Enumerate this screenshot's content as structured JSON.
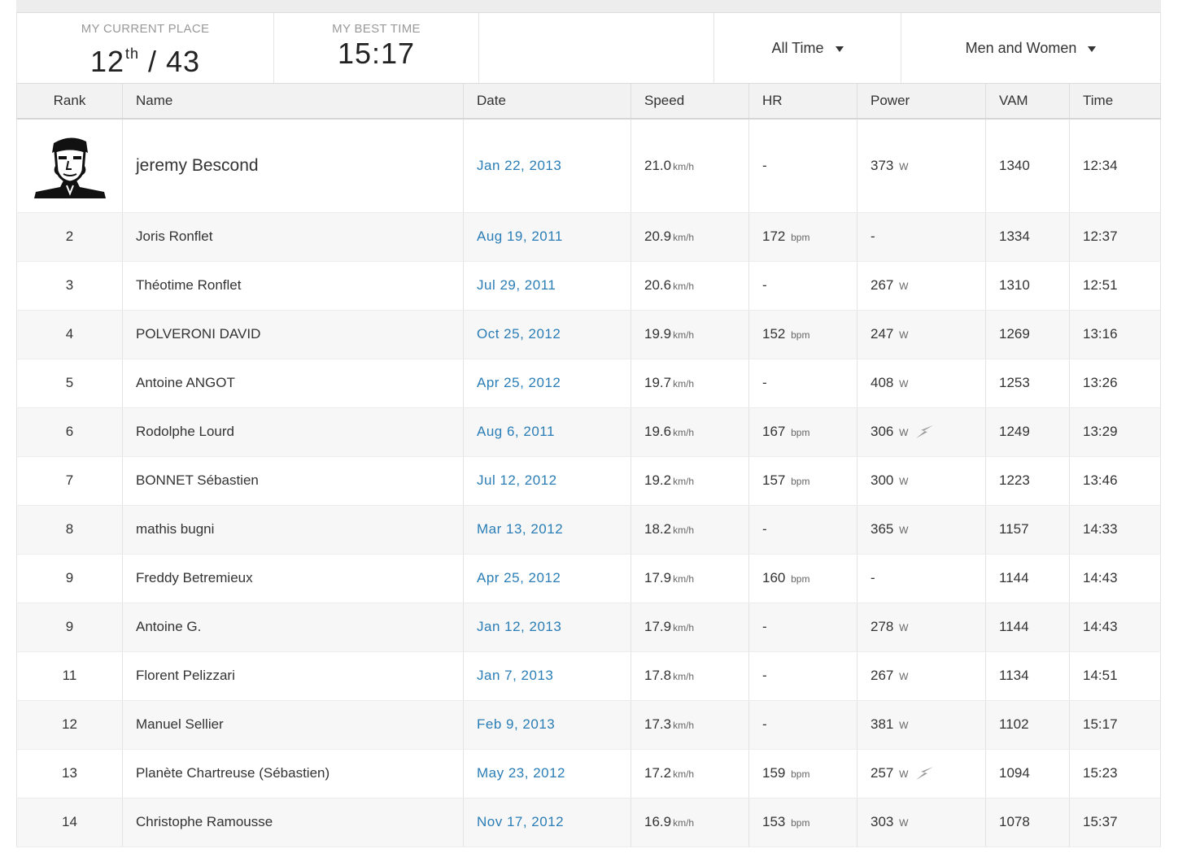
{
  "summary": {
    "current_place_label": "MY CURRENT PLACE",
    "current_place_rank": "12",
    "current_place_suffix": "th",
    "current_place_total": "/ 43",
    "best_time_label": "MY BEST TIME",
    "best_time_value": "15:17"
  },
  "filters": {
    "time_range": "All Time",
    "gender": "Men and Women"
  },
  "columns": [
    "Rank",
    "Name",
    "Date",
    "Speed",
    "HR",
    "Power",
    "VAM",
    "Time"
  ],
  "units": {
    "speed": "km/h",
    "hr": "bpm",
    "power": "W"
  },
  "leader": {
    "name": "jeremy Bescond",
    "date": "Jan 22, 2013",
    "speed": "21.0",
    "hr": "-",
    "power": "373",
    "vam": "1340",
    "time": "12:34"
  },
  "rows": [
    {
      "rank": "2",
      "name": "Joris Ronflet",
      "date": "Aug 19, 2011",
      "speed": "20.9",
      "hr": "172",
      "power": "-",
      "vam": "1334",
      "time": "12:37"
    },
    {
      "rank": "3",
      "name": "Théotime Ronflet",
      "date": "Jul 29, 2011",
      "speed": "20.6",
      "hr": "-",
      "power": "267",
      "vam": "1310",
      "time": "12:51"
    },
    {
      "rank": "4",
      "name": "POLVERONI DAVID",
      "date": "Oct 25, 2012",
      "speed": "19.9",
      "hr": "152",
      "power": "247",
      "vam": "1269",
      "time": "13:16"
    },
    {
      "rank": "5",
      "name": "Antoine ANGOT",
      "date": "Apr 25, 2012",
      "speed": "19.7",
      "hr": "-",
      "power": "408",
      "vam": "1253",
      "time": "13:26"
    },
    {
      "rank": "6",
      "name": "Rodolphe Lourd",
      "date": "Aug 6, 2011",
      "speed": "19.6",
      "hr": "167",
      "power": "306",
      "power_meter": true,
      "vam": "1249",
      "time": "13:29"
    },
    {
      "rank": "7",
      "name": "BONNET Sébastien",
      "date": "Jul 12, 2012",
      "speed": "19.2",
      "hr": "157",
      "power": "300",
      "vam": "1223",
      "time": "13:46"
    },
    {
      "rank": "8",
      "name": "mathis bugni",
      "date": "Mar 13, 2012",
      "speed": "18.2",
      "hr": "-",
      "power": "365",
      "vam": "1157",
      "time": "14:33"
    },
    {
      "rank": "9",
      "name": "Freddy Betremieux",
      "date": "Apr 25, 2012",
      "speed": "17.9",
      "hr": "160",
      "power": "-",
      "vam": "1144",
      "time": "14:43"
    },
    {
      "rank": "9",
      "name": "Antoine G.",
      "date": "Jan 12, 2013",
      "speed": "17.9",
      "hr": "-",
      "power": "278",
      "vam": "1144",
      "time": "14:43"
    },
    {
      "rank": "11",
      "name": "Florent Pelizzari",
      "date": "Jan 7, 2013",
      "speed": "17.8",
      "hr": "-",
      "power": "267",
      "vam": "1134",
      "time": "14:51"
    },
    {
      "rank": "12",
      "name": "Manuel Sellier",
      "date": "Feb 9, 2013",
      "speed": "17.3",
      "hr": "-",
      "power": "381",
      "vam": "1102",
      "time": "15:17"
    },
    {
      "rank": "13",
      "name": "Planète Chartreuse (Sébastien)",
      "date": "May 23, 2012",
      "speed": "17.2",
      "hr": "159",
      "power": "257",
      "power_meter": true,
      "vam": "1094",
      "time": "15:23"
    },
    {
      "rank": "14",
      "name": "Christophe Ramousse",
      "date": "Nov 17, 2012",
      "speed": "16.9",
      "hr": "153",
      "power": "303",
      "vam": "1078",
      "time": "15:37"
    }
  ],
  "colors": {
    "link": "#2a7db6",
    "header_bg": "#f2f2f2",
    "stripe_bg": "#f7f7f7"
  },
  "icons": {
    "dropdown": "caret-down-icon",
    "power_meter": "lightning-icon",
    "avatar": "avatar-icon"
  }
}
